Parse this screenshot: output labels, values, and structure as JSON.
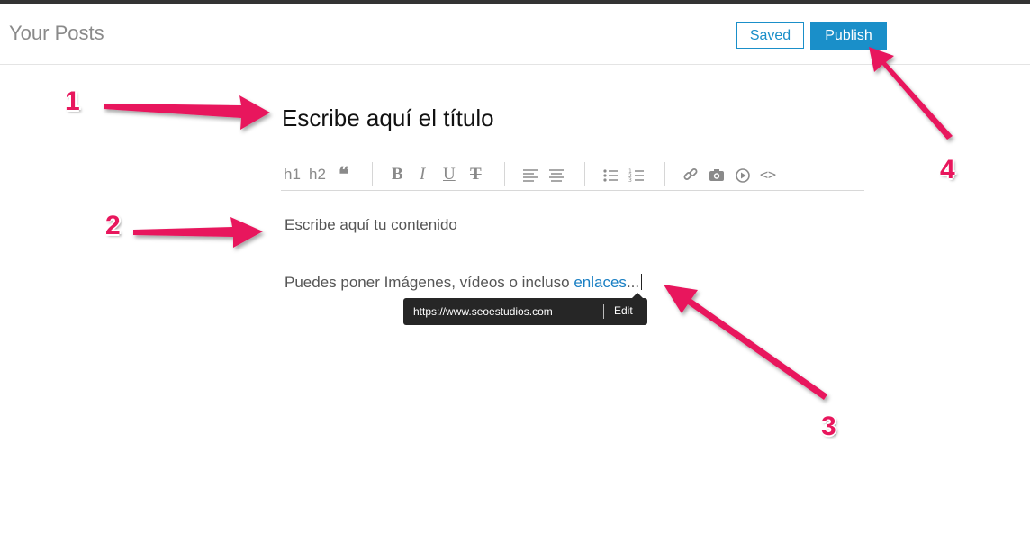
{
  "header": {
    "page_title": "Your Posts",
    "saved_label": "Saved",
    "publish_label": "Publish"
  },
  "editor": {
    "title_text": "Escribe aquí el título",
    "toolbar": {
      "h1": "h1",
      "h2": "h2",
      "quote": "66",
      "bold": "B",
      "italic": "I",
      "underline": "U",
      "strike": "T",
      "code": "<>"
    },
    "content_line1": "Escribe aquí tu contenido",
    "content_line2_prefix": "Puedes poner Imágenes, vídeos o incluso ",
    "content_link": "enlaces",
    "content_line2_suffix": "...",
    "link_tooltip": {
      "url": "https://www.seoestudios.com",
      "edit_label": "Edit"
    }
  },
  "annotations": {
    "n1": "1",
    "n2": "2",
    "n3": "3",
    "n4": "4",
    "color": "#e8175d"
  },
  "colors": {
    "accent": "#1a8fc9",
    "link": "#1a7fc3",
    "tooltip_bg": "#262626"
  }
}
